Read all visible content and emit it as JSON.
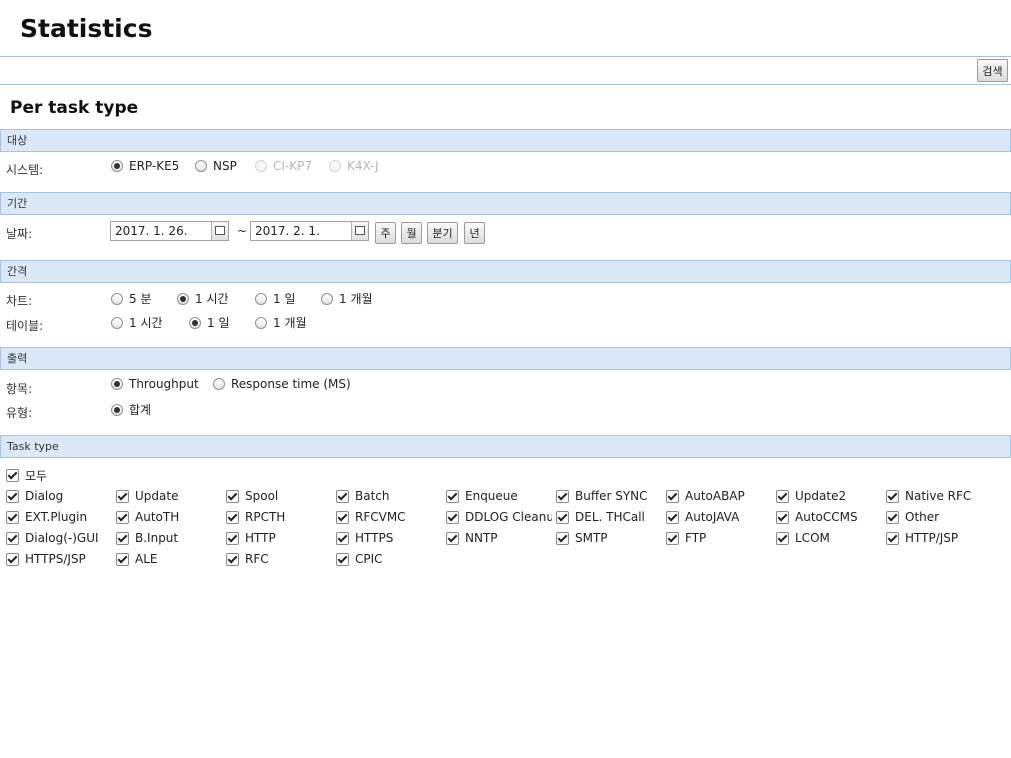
{
  "page": {
    "title": "Statistics",
    "subtitle": "Per task type"
  },
  "toolbar": {
    "search_label": "검색"
  },
  "sections": {
    "target": "대상",
    "period": "기간",
    "interval": "간격",
    "output": "출력",
    "task_type": "Task type"
  },
  "target": {
    "system_label": "시스템:",
    "systems": [
      {
        "label": "ERP-KE5",
        "selected": true,
        "disabled": false
      },
      {
        "label": "NSP",
        "selected": false,
        "disabled": false
      },
      {
        "label": "CI-KP7",
        "selected": false,
        "disabled": true
      },
      {
        "label": "K4X-J",
        "selected": false,
        "disabled": true
      }
    ]
  },
  "period": {
    "date_label": "날짜:",
    "from": "2017. 1. 26.",
    "separator": "~",
    "to": "2017. 2. 1.",
    "buttons": [
      "주",
      "월",
      "분기",
      "년"
    ]
  },
  "interval": {
    "chart_label": "차트:",
    "chart_options": [
      {
        "label": "5 분",
        "selected": false
      },
      {
        "label": "1 시간",
        "selected": true
      },
      {
        "label": "1 일",
        "selected": false
      },
      {
        "label": "1 개월",
        "selected": false
      }
    ],
    "table_label": "테이블:",
    "table_options": [
      {
        "label": "1 시간",
        "selected": false
      },
      {
        "label": "1 일",
        "selected": true
      },
      {
        "label": "1 개월",
        "selected": false
      }
    ]
  },
  "output": {
    "item_label": "항목:",
    "items": [
      {
        "label": "Throughput",
        "selected": true
      },
      {
        "label": "Response time (MS)",
        "selected": false
      }
    ],
    "type_label": "유형:",
    "types": [
      {
        "label": "합계",
        "selected": true
      }
    ]
  },
  "task_types": {
    "all_label": "모두",
    "rows": [
      [
        "Dialog",
        "Update",
        "Spool",
        "Batch",
        "Enqueue",
        "Buffer SYNC",
        "AutoABAP",
        "Update2",
        "Native RFC"
      ],
      [
        "EXT.Plugin",
        "AutoTH",
        "RPCTH",
        "RFCVMC",
        "DDLOG Cleanup",
        "DEL. THCall",
        "AutoJAVA",
        "AutoCCMS",
        "Other"
      ],
      [
        "Dialog(-)GUI",
        "B.Input",
        "HTTP",
        "HTTPS",
        "NNTP",
        "SMTP",
        "FTP",
        "LCOM",
        "HTTP/JSP"
      ],
      [
        "HTTPS/JSP",
        "ALE",
        "RFC",
        "CPIC"
      ]
    ]
  }
}
